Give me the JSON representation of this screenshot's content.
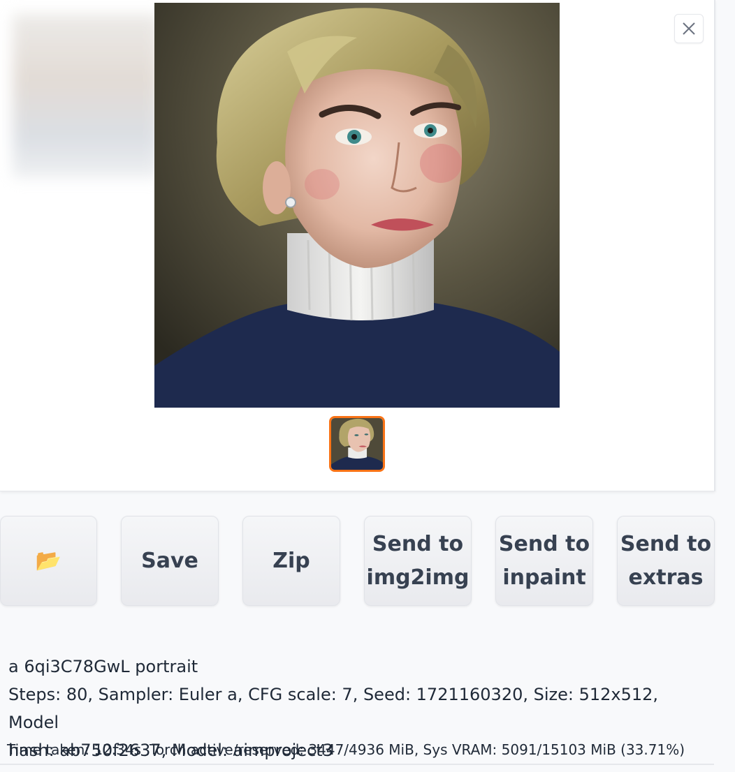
{
  "gallery": {
    "close_icon": "close-icon",
    "main_image_alt": "",
    "selected_thumbnail": 1
  },
  "buttons": {
    "open_folder_icon": "folder-icon",
    "open_folder_glyph": "📂",
    "save_label": "Save",
    "zip_label": "Zip",
    "send_img2img_line1": "Send to",
    "send_img2img_line2": "img2img",
    "send_inpaint_line1": "Send to",
    "send_inpaint_line2": "inpaint",
    "send_extras_line1": "Send to",
    "send_extras_line2": "extras"
  },
  "generation_info": {
    "prompt": "a 6qi3C78GwL portrait",
    "params_line1": "Steps: 80, Sampler: Euler a, CFG scale: 7, Seed: 1721160320, Size: 512x512, Model",
    "params_line2": "hash: ab750f2637, Model: aimproject3"
  },
  "performance": {
    "time_taken": "Time taken: 12.34s",
    "vram": "Torch active/reserved: 3447/4936 MiB, Sys VRAM: 5091/15103 MiB (33.71%)"
  },
  "colors": {
    "accent_orange": "#f97316",
    "background": "#f8f9fb",
    "button_text": "#374151"
  }
}
